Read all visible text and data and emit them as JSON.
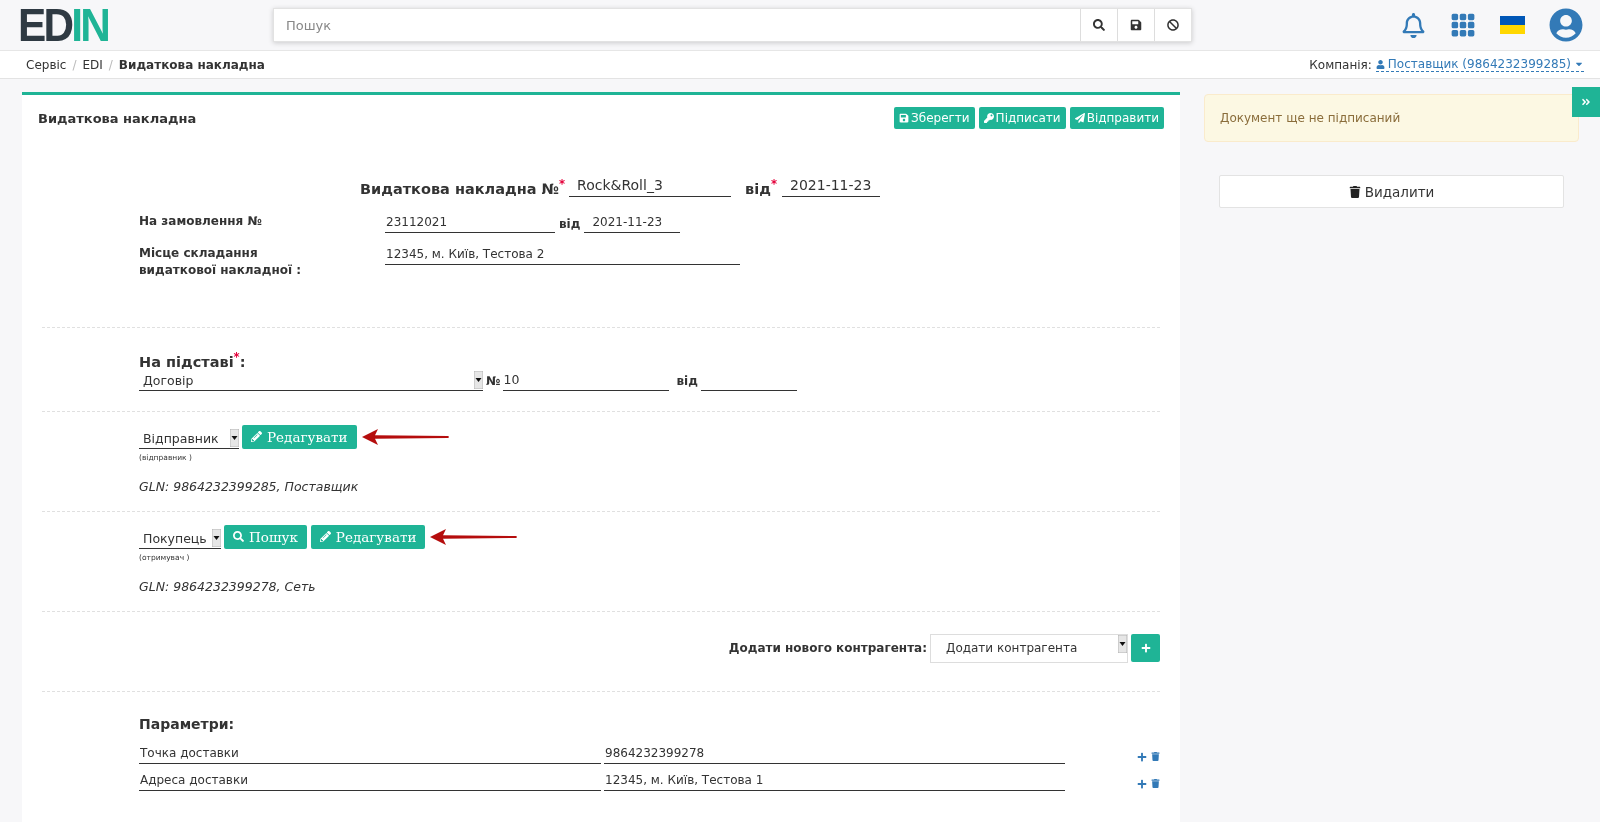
{
  "header": {
    "logo": {
      "text": "ED",
      "accent": "IN"
    },
    "search": {
      "placeholder": "Пошук"
    }
  },
  "breadcrumbs": [
    {
      "label": "Сервіс",
      "separator": "/",
      "selected": false
    },
    {
      "label": "EDI",
      "separator": "/",
      "selected": false
    },
    {
      "label": "Видаткова накладна",
      "selected": true
    }
  ],
  "company": {
    "label": "Компанія:",
    "value": "Поставщик (9864232399285)"
  },
  "panel": {
    "title": "Видаткова накладна",
    "actions": [
      {
        "kind": "save",
        "label": "Зберегти"
      },
      {
        "kind": "sign",
        "label": "Підписати"
      },
      {
        "kind": "send",
        "label": "Відправити"
      }
    ]
  },
  "document": {
    "title": "Видаткова накладна №$^{*}$",
    "number": "Rock&Roll_3",
    "date_label": "від$^{*}$",
    "date": "2021-11-23"
  },
  "order": {
    "label": "На замовлення №",
    "number": "23112021",
    "date_label": "від",
    "date": "2021-11-23"
  },
  "place": {
    "label": "Місце складання видаткової накладної :",
    "value": "12345, м. Київ, Тестова 2"
  },
  "basis": {
    "label": "На підставі$^{*}$:",
    "type": "Договір",
    "number_label": "№",
    "number": "10",
    "date_label": "від"
  },
  "parties": [
    {
      "role": "Відправник",
      "caption": "(відправник )",
      "highlighted": true,
      "buttons": [
        {
          "kind": "edit",
          "label": "Редагувати"
        }
      ],
      "gln": "GLN: 9864232399285, Поставщик"
    },
    {
      "role": "Покупець",
      "caption": "(отримувач )",
      "highlighted": true,
      "buttons": [
        {
          "kind": "search",
          "label": "Пошук"
        },
        {
          "kind": "edit",
          "label": "Редагувати"
        }
      ],
      "gln": "GLN: 9864232399278, Сеть"
    }
  ],
  "add_counterparty": {
    "label": "Додати нового контрагента:",
    "select": "Додати контрагента"
  },
  "parameters": {
    "title": "Параметри:",
    "rows": [
      {
        "name": "Точка доставки",
        "value": "9864232399278"
      },
      {
        "name": "Адреса доставки",
        "value": "12345, м. Київ, Тестова 1"
      }
    ]
  },
  "sidebar": {
    "alert": "Документ ще не підписаний",
    "delete_button": "Видалити"
  }
}
